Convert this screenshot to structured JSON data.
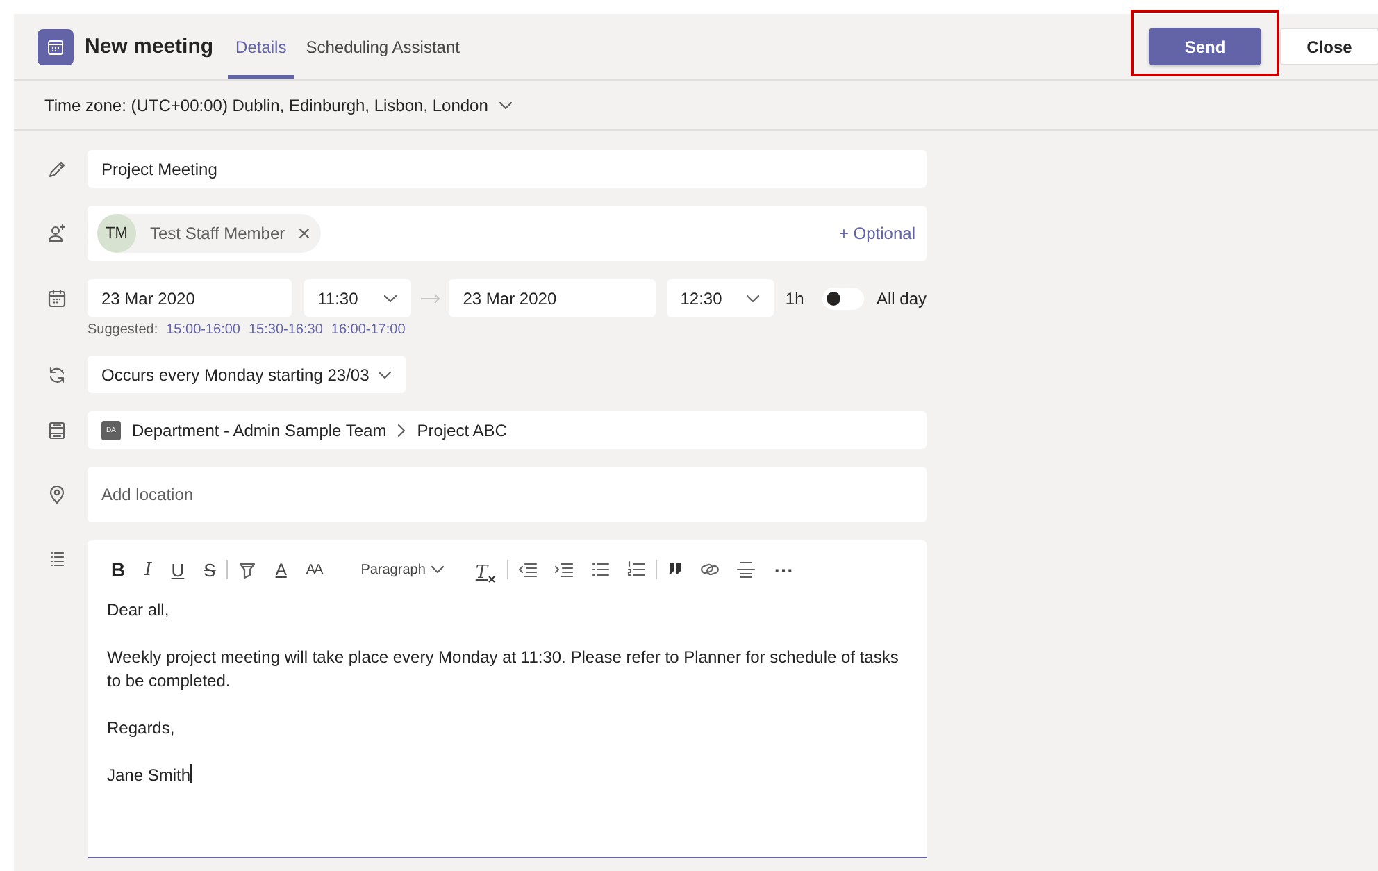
{
  "header": {
    "title": "New meeting",
    "tabs": [
      {
        "label": "Details",
        "selected": true
      },
      {
        "label": "Scheduling Assistant",
        "selected": false
      }
    ],
    "buttons": [
      {
        "label": "Send",
        "kind": "primary",
        "highlighted": true
      },
      {
        "label": "Close",
        "kind": "secondary",
        "highlighted": false
      }
    ]
  },
  "time_zone": {
    "label": "Time zone: (UTC+00:00) Dublin, Edinburgh, Lisbon, London"
  },
  "title_field": {
    "value": "Project Meeting"
  },
  "attendees": {
    "people": [
      {
        "initials": "TM",
        "name": "Test Staff Member"
      }
    ],
    "optional_link": "+ Optional"
  },
  "schedule": {
    "start_date": "23 Mar 2020",
    "start_time": "11:30",
    "end_date": "23 Mar 2020",
    "end_time": "12:30",
    "duration": "1h",
    "all_day": {
      "label": "All day",
      "on": false
    },
    "suggested_label": "Suggested:",
    "suggestions": [
      "15:00-16:00",
      "15:30-16:30",
      "16:00-17:00"
    ]
  },
  "recurrence": {
    "value": "Occurs every Monday starting 23/03"
  },
  "channel": {
    "team_initials": "DA",
    "team": "Department - Admin Sample Team",
    "channel": "Project ABC"
  },
  "location": {
    "placeholder": "Add location"
  },
  "editor": {
    "toolbar": [
      {
        "kind": "bold",
        "label": "B"
      },
      {
        "kind": "italic",
        "label": "I"
      },
      {
        "kind": "underline",
        "label": "U"
      },
      {
        "kind": "strike",
        "label": "S"
      },
      {
        "kind": "separator"
      },
      {
        "kind": "highlight"
      },
      {
        "kind": "font-color",
        "label": "A"
      },
      {
        "kind": "font-size",
        "label": "AA"
      },
      {
        "kind": "dropdown",
        "label": "Paragraph"
      },
      {
        "kind": "clear",
        "label": "T"
      },
      {
        "kind": "separator"
      },
      {
        "kind": "outdent"
      },
      {
        "kind": "indent"
      },
      {
        "kind": "bullets"
      },
      {
        "kind": "numbers"
      },
      {
        "kind": "separator"
      },
      {
        "kind": "quote"
      },
      {
        "kind": "link"
      },
      {
        "kind": "rule"
      },
      {
        "kind": "more",
        "label": "⋯"
      }
    ],
    "paragraphs": [
      "Dear all,",
      "Weekly project meeting will take place every Monday at 11:30. Please refer to Planner for schedule of tasks to be completed.",
      "Regards,",
      "Jane Smith"
    ]
  }
}
